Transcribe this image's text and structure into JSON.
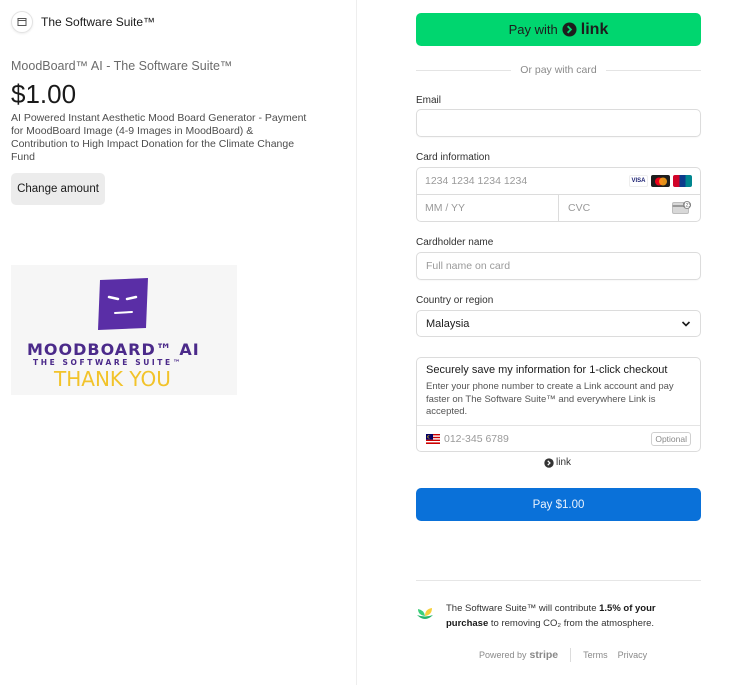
{
  "merchant": {
    "name": "The Software Suite™"
  },
  "product": {
    "name": "MoodBoard™ AI - The Software Suite™",
    "price": "$1.00",
    "description": "AI Powered Instant Aesthetic Mood Board Generator - Payment for MoodBoard Image (4-9 Images in MoodBoard) & Contribution to High Impact Donation for the Climate Change Fund",
    "change_amount_label": "Change amount",
    "image": {
      "title": "MOODBOARD™ AI",
      "subtitle": "THE SOFTWARE SUITE™",
      "thanks": "THANK YOU"
    }
  },
  "checkout": {
    "link_button_prefix": "Pay with",
    "link_button_brand": "link",
    "or_text": "Or pay with card",
    "email_label": "Email",
    "email_value": "",
    "card_label": "Card information",
    "card_number_placeholder": "1234 1234 1234 1234",
    "card_expiry_placeholder": "MM / YY",
    "card_cvc_placeholder": "CVC",
    "card_brands": [
      "VISA",
      "mastercard",
      "UnionPay"
    ],
    "cardholder_label": "Cardholder name",
    "cardholder_placeholder": "Full name on card",
    "country_label": "Country or region",
    "country_value": "Malaysia",
    "save_title": "Securely save my information for 1-click checkout",
    "save_description": "Enter your phone number to create a Link account and pay faster on The Software Suite™ and everywhere Link is accepted.",
    "phone_placeholder": "012-345 6789",
    "optional_label": "Optional",
    "link_mark": "link",
    "pay_button": "Pay $1.00"
  },
  "climate": {
    "text_before": "The Software Suite™ will contribute",
    "text_bold": "1.5% of your purchase",
    "text_after": "to removing CO₂ from the atmosphere."
  },
  "footer": {
    "powered_by": "Powered by",
    "stripe": "stripe",
    "terms": "Terms",
    "privacy": "Privacy"
  },
  "colors": {
    "link_green": "#00d66f",
    "pay_blue": "#0a71d9",
    "moodboard_purple": "#5a2ea6",
    "thanks_yellow": "#f2c32a"
  }
}
